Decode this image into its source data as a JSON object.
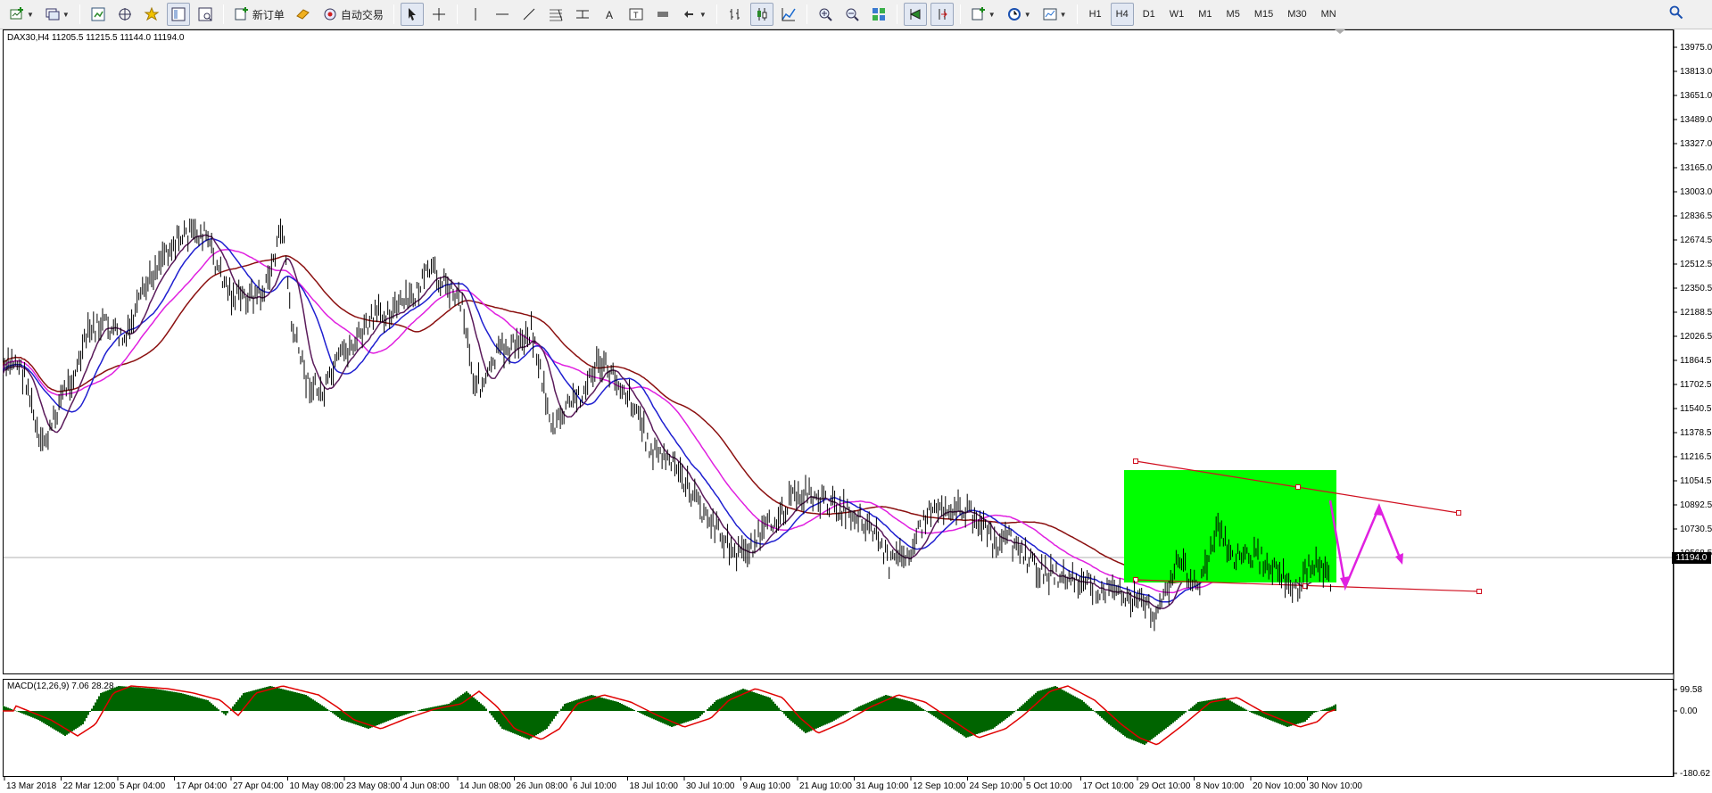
{
  "toolbar": {
    "buttons": [
      {
        "name": "new-chart-button",
        "icon": "new-chart-icon",
        "label": ""
      },
      {
        "name": "profiles-button",
        "icon": "profiles-icon",
        "label": ""
      },
      {
        "name": "market-watch-button",
        "icon": "market-watch-icon",
        "label": ""
      },
      {
        "name": "navigator-button",
        "icon": "navigator-icon",
        "label": ""
      },
      {
        "name": "data-window-button",
        "icon": "star-icon",
        "label": ""
      },
      {
        "name": "terminal-button",
        "icon": "terminal-icon",
        "label": ""
      },
      {
        "name": "strategy-tester-button",
        "icon": "tester-icon",
        "label": ""
      }
    ],
    "new_order_label": "新订单",
    "auto_trade_label": "自动交易",
    "timeframes": [
      "H1",
      "H4",
      "D1",
      "W1",
      "M1",
      "M5",
      "M15",
      "M30",
      "MN"
    ],
    "active_timeframe": "H4"
  },
  "chart": {
    "info": "DAX30,H4  11205.5 11215.5 11144.0 11194.0",
    "current_price": "11194.0",
    "price_labels": [
      "13975.0",
      "13813.0",
      "13651.0",
      "13489.0",
      "13327.0",
      "13165.0",
      "13003.0",
      "12836.5",
      "12674.5",
      "12512.5",
      "12350.5",
      "12188.5",
      "12026.5",
      "11864.5",
      "11702.5",
      "11540.5",
      "11378.5",
      "11216.5",
      "11054.5",
      "10892.5",
      "10730.5",
      "10568.5"
    ],
    "time_labels": [
      "13 Mar 2018",
      "22 Mar 12:00",
      "5 Apr 04:00",
      "17 Apr 04:00",
      "27 Apr 04:00",
      "10 May 08:00",
      "23 May 08:00",
      "4 Jun 08:00",
      "14 Jun 08:00",
      "26 Jun 08:00",
      "6 Jul 10:00",
      "18 Jul 10:00",
      "30 Jul 10:00",
      "9 Aug 10:00",
      "21 Aug 10:00",
      "31 Aug 10:00",
      "12 Sep 10:00",
      "24 Sep 10:00",
      "5 Oct 10:00",
      "17 Oct 10:00",
      "29 Oct 10:00",
      "8 Nov 10:00",
      "20 Nov 10:00",
      "30 Nov 10:00"
    ],
    "colors": {
      "ma_blue": "#1f1fd0",
      "ma_magenta": "#e020e0",
      "ma_darkred": "#8b1010",
      "ma_purple": "#5a1a5a",
      "trendline": "#d01020",
      "box": "#00ff00",
      "arrow": "#e020e0",
      "macd_hist": "#006400",
      "macd_signal": "#e00000"
    }
  },
  "macd": {
    "info": "MACD(12,26,9) 7.06 28.28",
    "labels": [
      "99.58",
      "0.00",
      "-180.62"
    ]
  }
}
